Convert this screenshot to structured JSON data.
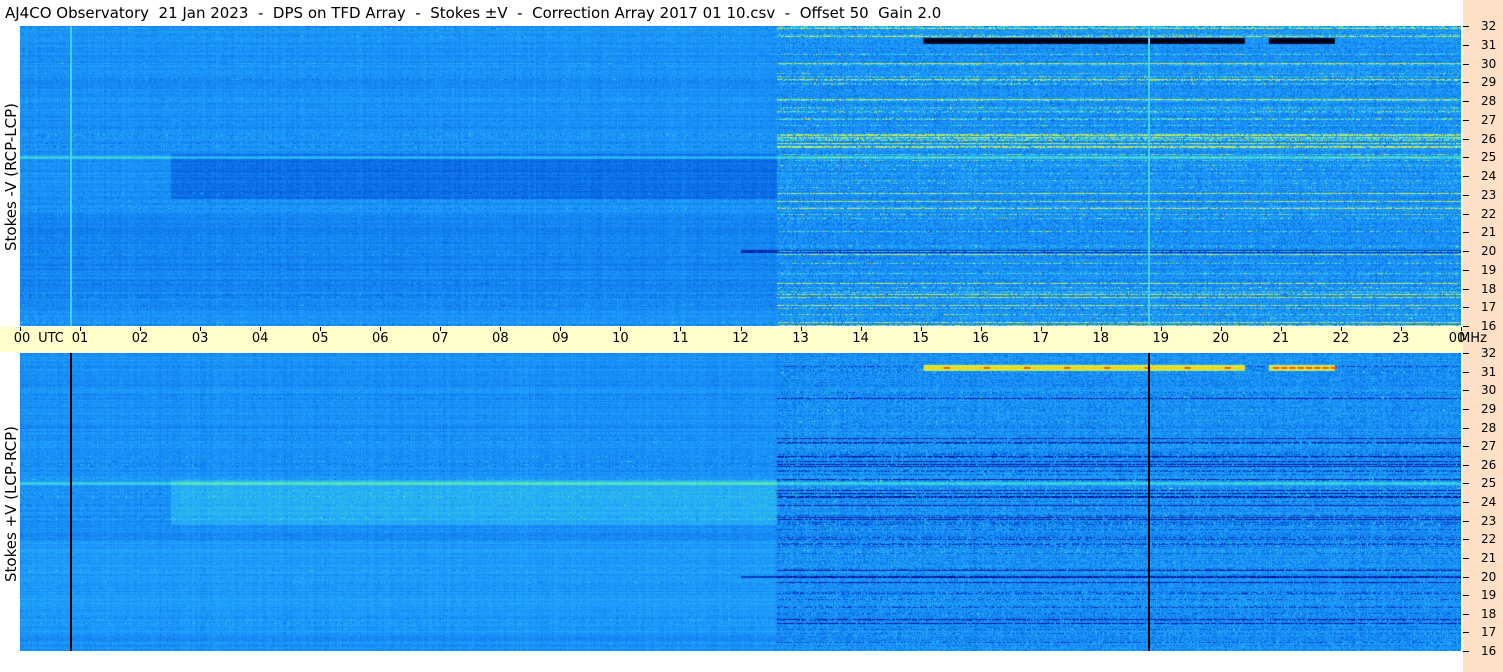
{
  "title": "AJ4CO Observatory  21 Jan 2023  -  DPS on TFD Array  -  Stokes ±V  -  Correction Array 2017 01 10.csv  -  Offset 50  Gain 2.0",
  "chart_data": [
    {
      "type": "heatmap",
      "panel": "top",
      "ylabel": "Stokes -V (RCP-LCP)",
      "x_axis": {
        "unit": "UTC",
        "ticks": [
          "00",
          "01",
          "02",
          "03",
          "04",
          "05",
          "06",
          "07",
          "08",
          "09",
          "10",
          "11",
          "12",
          "13",
          "14",
          "15",
          "16",
          "17",
          "18",
          "19",
          "20",
          "21",
          "22",
          "23",
          "00"
        ],
        "range_hours": [
          0,
          24
        ]
      },
      "y_axis": {
        "unit": "MHz",
        "ticks": [
          16,
          17,
          18,
          19,
          20,
          21,
          22,
          23,
          24,
          25,
          26,
          27,
          28,
          29,
          30,
          31,
          32
        ],
        "range": [
          16,
          32
        ]
      },
      "colormap": [
        "#00008a",
        "#0050d8",
        "#1fa0ff",
        "#40e0d0",
        "#c8f060",
        "#ffd000",
        "#ff3000"
      ],
      "marker_lines_utc": [
        0.83,
        18.78
      ],
      "marker_line_color": "#3fd3ff",
      "features": [
        {
          "kind": "dark-band",
          "utc_start": 15.05,
          "utc_end": 20.4,
          "mhz": 31.2
        },
        {
          "kind": "dark-band",
          "utc_start": 20.8,
          "utc_end": 21.9,
          "mhz": 31.2
        },
        {
          "kind": "darker-region",
          "utc_start": 2.5,
          "utc_end": 12.6,
          "mhz_start": 23.0,
          "mhz_end": 25.0
        },
        {
          "kind": "rfi-activity",
          "utc_start": 12.6,
          "utc_end": 24.0
        }
      ]
    },
    {
      "type": "heatmap",
      "panel": "bottom",
      "ylabel": "Stokes +V (LCP-RCP)",
      "x_axis": {
        "unit": "UTC",
        "range_hours": [
          0,
          24
        ]
      },
      "y_axis": {
        "unit": "MHz",
        "ticks": [
          16,
          17,
          18,
          19,
          20,
          21,
          22,
          23,
          24,
          25,
          26,
          27,
          28,
          29,
          30,
          31,
          32
        ],
        "range": [
          16,
          32
        ]
      },
      "colormap": [
        "#00008a",
        "#0050d8",
        "#1fa0ff",
        "#40e0d0",
        "#c8f060",
        "#ffd000",
        "#ff3000"
      ],
      "marker_lines_utc": [
        0.83,
        18.78
      ],
      "marker_line_color": "#000000",
      "features": [
        {
          "kind": "bright-band",
          "utc_start": 15.05,
          "utc_end": 20.4,
          "mhz": 31.2
        },
        {
          "kind": "bright-band",
          "utc_start": 20.8,
          "utc_end": 21.9,
          "mhz": 31.2
        },
        {
          "kind": "lighter-region",
          "utc_start": 2.5,
          "utc_end": 12.6,
          "mhz_start": 23.0,
          "mhz_end": 25.0
        },
        {
          "kind": "rfi-activity",
          "utc_start": 12.6,
          "utc_end": 24.0
        }
      ]
    }
  ],
  "axis_labels": {
    "utc": "UTC",
    "mhz": "MHz"
  }
}
